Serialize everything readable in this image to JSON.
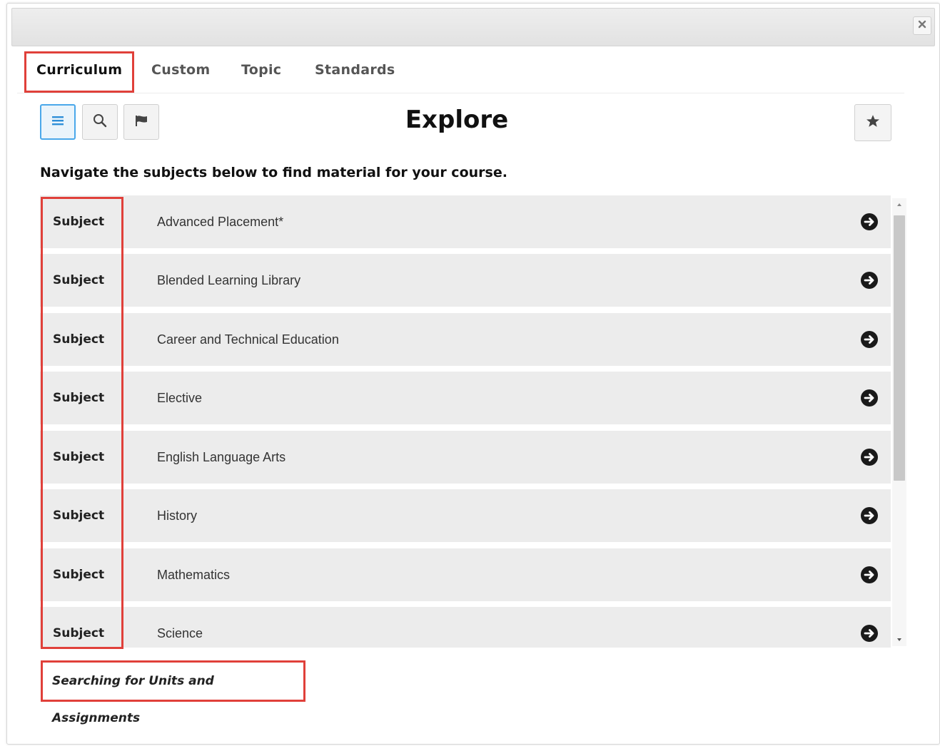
{
  "dialog": {
    "close_icon": "close-icon"
  },
  "tabs": [
    {
      "label": "Curriculum",
      "active": true
    },
    {
      "label": "Custom",
      "active": false
    },
    {
      "label": "Topic",
      "active": false
    },
    {
      "label": "Standards",
      "active": false
    }
  ],
  "toolbar": {
    "buttons": [
      {
        "icon": "list-icon",
        "active": true
      },
      {
        "icon": "search-icon",
        "active": false
      },
      {
        "icon": "flag-icon",
        "active": false
      }
    ],
    "favorite_icon": "star-icon"
  },
  "page": {
    "title": "Explore",
    "instructions": "Navigate the subjects below to find material for your course."
  },
  "subjects": [
    {
      "kind": "Subject",
      "name": "Advanced Placement*"
    },
    {
      "kind": "Subject",
      "name": "Blended Learning Library"
    },
    {
      "kind": "Subject",
      "name": "Career and Technical Education"
    },
    {
      "kind": "Subject",
      "name": "Elective"
    },
    {
      "kind": "Subject",
      "name": "English Language Arts"
    },
    {
      "kind": "Subject",
      "name": "History"
    },
    {
      "kind": "Subject",
      "name": "Mathematics"
    },
    {
      "kind": "Subject",
      "name": "Science"
    }
  ],
  "footer": {
    "search_help_label": "Searching for Units and Assignments"
  },
  "colors": {
    "highlight": "#e0403a",
    "active_button": "#4aa8ea",
    "row_background": "#ececec"
  }
}
